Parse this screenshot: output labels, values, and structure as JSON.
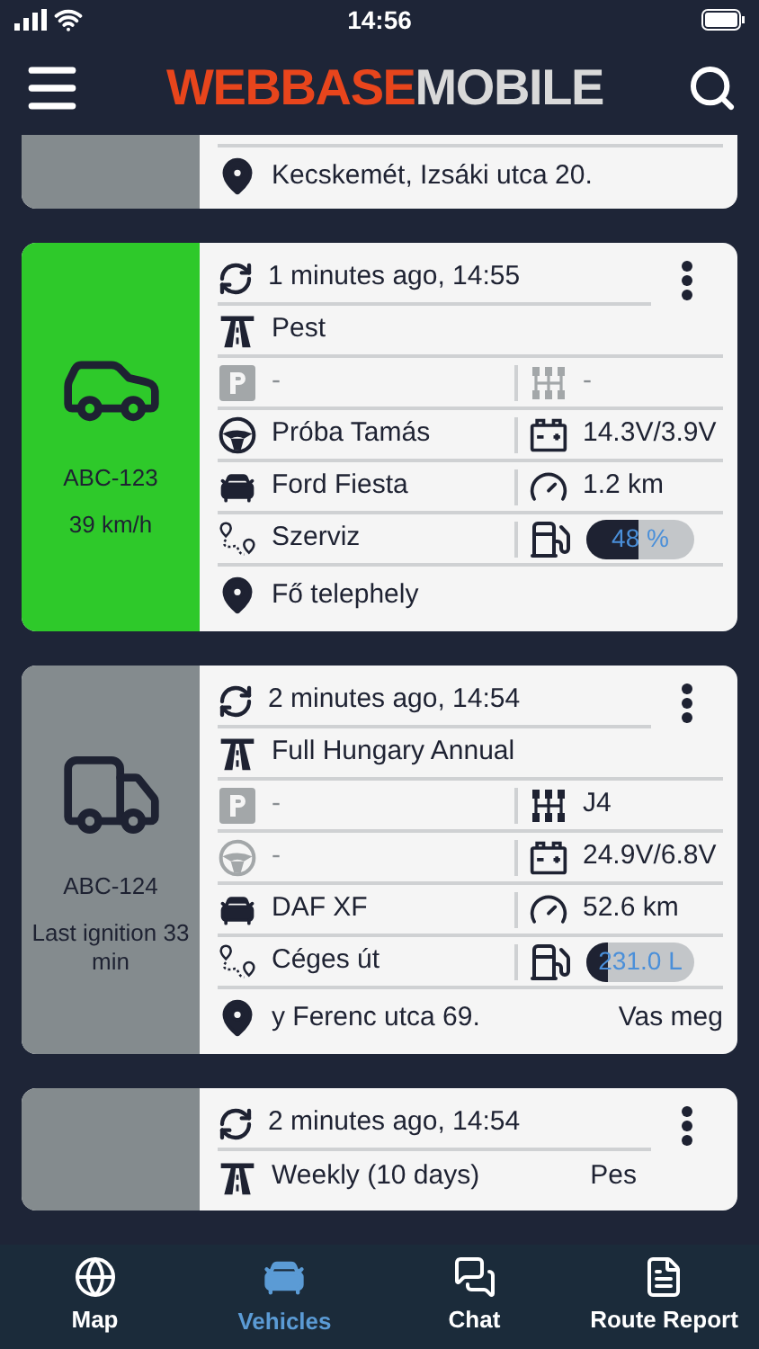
{
  "status_bar": {
    "time": "14:56"
  },
  "header": {
    "logo": [
      {
        "text": "WEBBASE",
        "kind": "accent"
      },
      {
        "text": "MOBILE",
        "kind": "plain"
      }
    ]
  },
  "vehicles": [
    {
      "color": "#848b8e",
      "rows": [
        {
          "kind": "address",
          "text": "Kecskemét, Izsáki utca 20."
        }
      ]
    },
    {
      "color": "#2ec92a",
      "kind": "car",
      "plate": "ABC-123",
      "status": "39 km/h",
      "rows": [
        {
          "kind": "updated",
          "text": "1 minutes ago, 14:55"
        },
        {
          "kind": "vignette",
          "text": "Pest"
        },
        {
          "kind": "pair",
          "left": {
            "kind": "parking",
            "text": "-",
            "active": false
          },
          "right": {
            "kind": "gearbox",
            "text": "-",
            "active": false
          }
        },
        {
          "kind": "pair",
          "left": {
            "kind": "driver",
            "text": "Próba Tamás",
            "active": true
          },
          "right": {
            "kind": "battery",
            "text": "14.3V/3.9V",
            "active": true
          }
        },
        {
          "kind": "pair",
          "left": {
            "kind": "model",
            "text": "Ford Fiesta",
            "active": true
          },
          "right": {
            "kind": "odometer",
            "text": "1.2 km",
            "active": true
          }
        },
        {
          "kind": "pair",
          "left": {
            "kind": "route",
            "text": "Szerviz",
            "active": true
          },
          "right": {
            "kind": "fuel",
            "text": "48 %",
            "level": 0.48
          }
        },
        {
          "kind": "address",
          "text": "Fő telephely"
        }
      ]
    },
    {
      "color": "#848b8e",
      "kind": "truck",
      "plate": "ABC-124",
      "status": "Last ignition 33 min",
      "rows": [
        {
          "kind": "updated",
          "text": "2 minutes ago, 14:54"
        },
        {
          "kind": "vignette",
          "text": "Full Hungary Annual"
        },
        {
          "kind": "pair",
          "left": {
            "kind": "parking",
            "text": "-",
            "active": false
          },
          "right": {
            "kind": "gearbox",
            "text": "J4",
            "active": true
          }
        },
        {
          "kind": "pair",
          "left": {
            "kind": "driver",
            "text": "-",
            "active": false
          },
          "right": {
            "kind": "battery",
            "text": "24.9V/6.8V",
            "active": true
          }
        },
        {
          "kind": "pair",
          "left": {
            "kind": "model",
            "text": "DAF XF",
            "active": true
          },
          "right": {
            "kind": "odometer",
            "text": "52.6 km",
            "active": true
          }
        },
        {
          "kind": "pair",
          "left": {
            "kind": "route",
            "text": "Céges út",
            "active": true
          },
          "right": {
            "kind": "fuel",
            "text": "231.0 L",
            "level": 0.2
          }
        },
        {
          "kind": "address",
          "text": "y Ferenc utca 69.",
          "extra": "Vas meg"
        }
      ]
    },
    {
      "color": "#848b8e",
      "rows": [
        {
          "kind": "updated",
          "text": "2 minutes ago, 14:54"
        },
        {
          "kind": "vignette",
          "text": "Weekly (10 days)",
          "extra": "Pes"
        }
      ]
    }
  ],
  "nav": [
    {
      "kind": "map",
      "label": "Map",
      "selected": false
    },
    {
      "kind": "vehicles",
      "label": "Vehicles",
      "selected": true
    },
    {
      "kind": "chat",
      "label": "Chat",
      "selected": false
    },
    {
      "kind": "report",
      "label": "Route Report",
      "selected": false
    }
  ]
}
